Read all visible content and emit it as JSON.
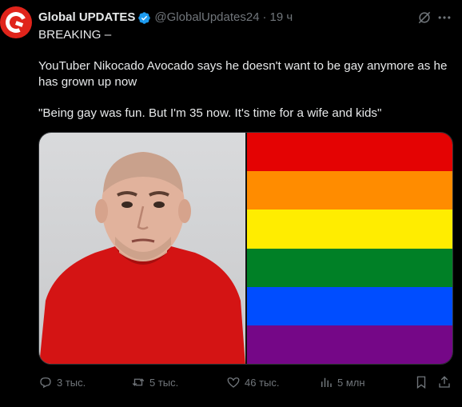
{
  "author": {
    "name": "Global UPDATES",
    "handle": "@GlobalUpdates24",
    "separator": "·",
    "time": "19 ч",
    "avatar_letter": "G"
  },
  "tweet": {
    "paragraphs": [
      "BREAKING –",
      "YouTuber Nikocado Avocado says he doesn't want to be gay anymore as he has grown up now",
      "\"Being gay was fun. But I'm 35 now. It's time for a wife and kids\""
    ]
  },
  "media": {
    "flag_colors": [
      "#e40303",
      "#ff8c00",
      "#ffed00",
      "#008026",
      "#004dff",
      "#750787"
    ]
  },
  "actions": {
    "replies": "3 тыс.",
    "reposts": "5 тыс.",
    "likes": "46 тыс.",
    "views": "5 млн"
  },
  "colors": {
    "background": "#000000",
    "text": "#e7e9ea",
    "muted": "#71767b",
    "verified": "#1d9bf0",
    "avatar": "#e0241b"
  }
}
